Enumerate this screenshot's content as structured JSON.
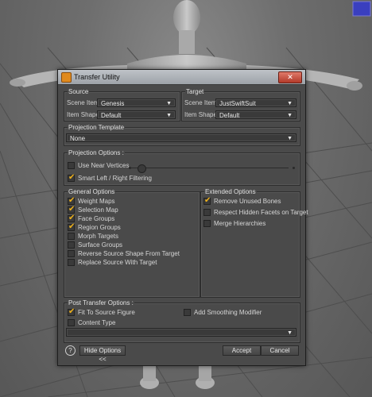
{
  "dialog": {
    "title": "Transfer Utility",
    "close_label": "✕"
  },
  "source": {
    "group_label": "Source",
    "scene_item_label": "Scene Item :",
    "scene_item_value": "Genesis",
    "item_shape_label": "Item Shape :",
    "item_shape_value": "Default"
  },
  "target": {
    "group_label": "Target",
    "scene_item_label": "Scene Item :",
    "scene_item_value": "JustSwiftSuit",
    "item_shape_label": "Item Shape :",
    "item_shape_value": "Default"
  },
  "projection_template": {
    "group_label": "Projection Template",
    "value": "None"
  },
  "projection_options": {
    "group_label": "Projection Options :",
    "use_near_vertices": {
      "label": "Use Near Vertices",
      "checked": false
    },
    "smart_filtering": {
      "label": "Smart Left / Right Filtering",
      "checked": true
    }
  },
  "general_options": {
    "group_label": "General Options",
    "items": [
      {
        "label": "Weight Maps",
        "checked": true
      },
      {
        "label": "Selection Map",
        "checked": true
      },
      {
        "label": "Face Groups",
        "checked": true
      },
      {
        "label": "Region Groups",
        "checked": true
      },
      {
        "label": "Morph Targets",
        "checked": false
      },
      {
        "label": "Surface Groups",
        "checked": false
      },
      {
        "label": "Reverse Source Shape From Target",
        "checked": false
      },
      {
        "label": "Replace Source With Target",
        "checked": false
      }
    ]
  },
  "extended_options": {
    "group_label": "Extended Options",
    "items": [
      {
        "label": "Remove Unused Bones",
        "checked": true
      },
      {
        "label": "Respect Hidden Facets on Target",
        "checked": false
      },
      {
        "label": "Merge Hierarchies",
        "checked": false
      }
    ]
  },
  "post_transfer": {
    "group_label": "Post Transfer Options :",
    "fit_to_source": {
      "label": "Fit To Source Figure",
      "checked": true
    },
    "add_smoothing": {
      "label": "Add Smoothing Modifier",
      "checked": false
    },
    "content_type": {
      "label": "Content Type",
      "checked": false
    },
    "content_type_value": ""
  },
  "footer": {
    "help_label": "?",
    "hide_options_label": "Hide Options <<",
    "accept_label": "Accept",
    "cancel_label": "Cancel"
  },
  "icons": {
    "dropdown": "chevron-down-icon",
    "checkmark": "checkmark-icon",
    "help": "help-icon"
  },
  "colors": {
    "checkmark": "#f0b21a",
    "dialog_bg": "#4a4a4a",
    "app_icon": "#e08a1e"
  }
}
